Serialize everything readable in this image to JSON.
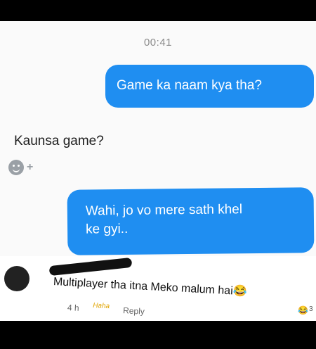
{
  "conversation": {
    "timestamp": "00:41",
    "messages": [
      {
        "direction": "outgoing",
        "text": "Game ka naam kya tha?"
      },
      {
        "direction": "incoming",
        "text": "Kaunsa game?"
      },
      {
        "direction": "outgoing",
        "lines": [
          "Wahi, jo vo mere sath khel",
          "ke gyi.."
        ]
      }
    ],
    "reaction_row": {
      "icon": "smiley-icon",
      "plus": "+"
    }
  },
  "comment": {
    "text": "Multiplayer tha itna Meko malum hai",
    "time": "4 h",
    "reaction_label": "Haha",
    "reply_label": "Reply",
    "reaction_count": "3",
    "emoji": "😂"
  },
  "colors": {
    "bubble_out": "#1f8ef1",
    "text_dark": "#1d1d1d",
    "timestamp": "#8b8b8b"
  }
}
